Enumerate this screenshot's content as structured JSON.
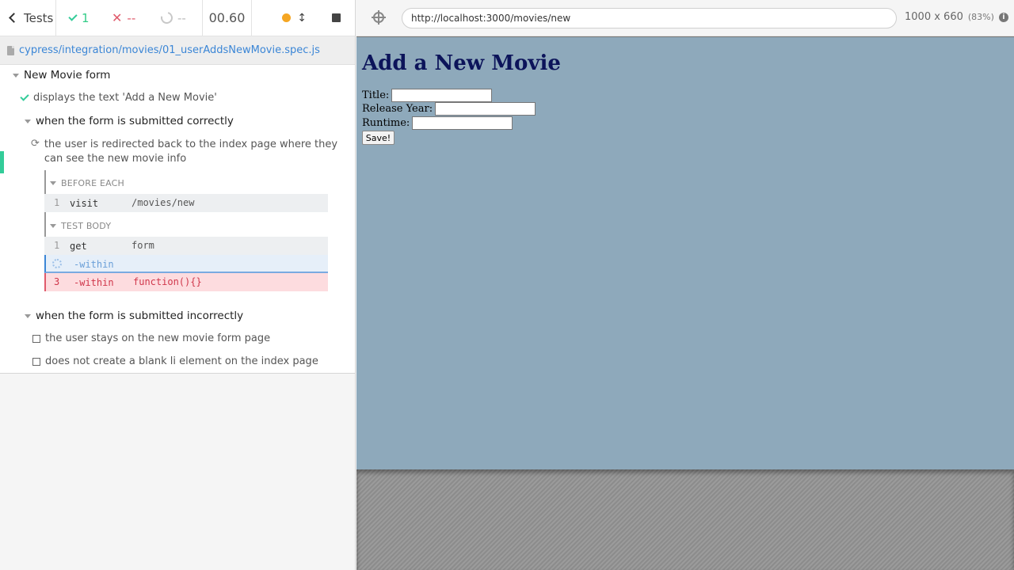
{
  "stats": {
    "tests_label": "Tests",
    "passed": "1",
    "failed": "--",
    "pending": "--",
    "duration": "00.60"
  },
  "spec_path": "cypress/integration/movies/01_userAddsNewMovie.spec.js",
  "runnables": {
    "root_suite": "New Movie form",
    "test_passed": "displays the text 'Add a New Movie'",
    "suite_correct": "when the form is submitted correctly",
    "test_running": {
      "line1": "the user is redirected back to the index page where they",
      "line2": "can see the new movie info"
    },
    "before_each_label": "BEFORE EACH",
    "before_each_cmds": [
      {
        "num": "1",
        "name": "visit",
        "msg": "/movies/new"
      }
    ],
    "test_body_label": "TEST BODY",
    "test_body_cmds": [
      {
        "num": "1",
        "name": "get",
        "msg": "form"
      },
      {
        "num": "",
        "name": "-within",
        "msg": ""
      },
      {
        "num": "3",
        "name": "-within",
        "msg": "function(){}"
      }
    ],
    "suite_incorrect": "when the form is submitted incorrectly",
    "pending_tests": [
      "the user stays on the new movie form page",
      "does not create a blank li element on the index page"
    ]
  },
  "app": {
    "url": "http://localhost:3000/movies/new",
    "viewport": "1000 x 660",
    "scale": "(83%)",
    "heading": "Add a New Movie",
    "fields": [
      {
        "label": "Title:"
      },
      {
        "label": "Release Year:"
      },
      {
        "label": "Runtime:"
      }
    ],
    "save_label": "Save!"
  },
  "colors": {
    "passed": "#33cc99",
    "failed": "#e05a6b",
    "link": "#3b86d6",
    "aut_background": "#8ea9bb",
    "heading": "#0c145a"
  }
}
